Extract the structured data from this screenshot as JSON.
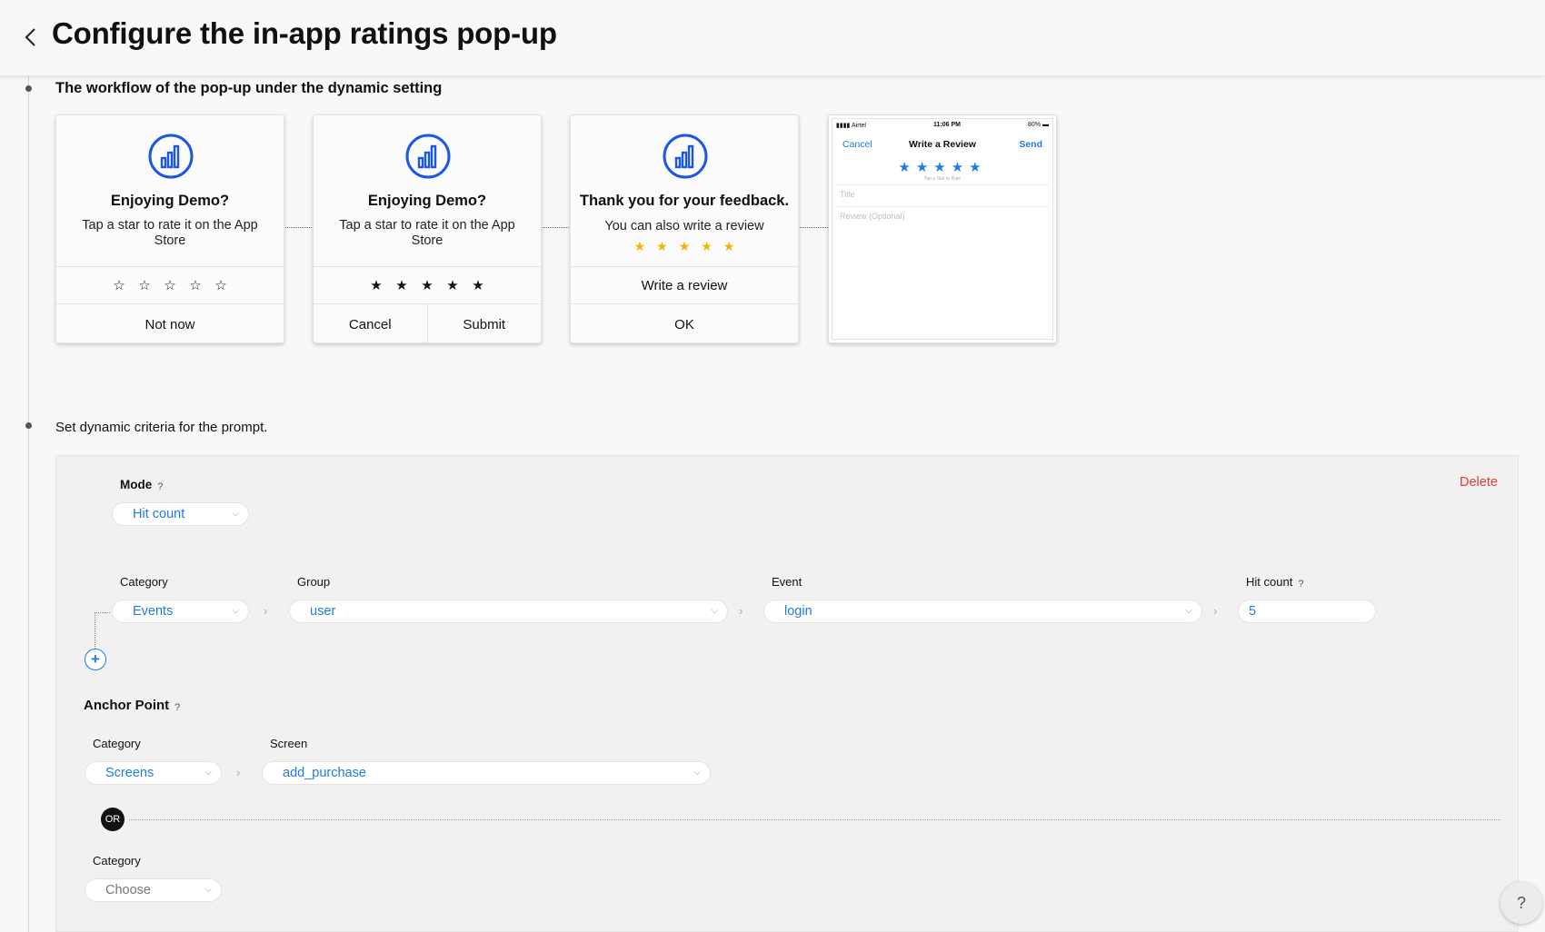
{
  "header": {
    "title": "Configure the in-app ratings pop-up",
    "back_icon": "chevron-left-icon"
  },
  "workflow": {
    "heading": "The workflow of the pop-up under the dynamic setting",
    "cards": [
      {
        "title": "Enjoying Demo?",
        "message": "Tap a star to rate it on the App Store",
        "stars": "empty",
        "actions": [
          "Not now"
        ]
      },
      {
        "title": "Enjoying Demo?",
        "message": "Tap a star to rate it on the App Store",
        "stars": "filled",
        "actions": [
          "Cancel",
          "Submit"
        ]
      },
      {
        "title": "Thank you for your feedback.",
        "message": "You can also write a review",
        "stars": "gold",
        "review_label": "Write a review",
        "actions": [
          "OK"
        ]
      }
    ],
    "phone": {
      "carrier": "Airtel",
      "time": "11:06 PM",
      "battery": "80%",
      "cancel": "Cancel",
      "title": "Write a Review",
      "send": "Send",
      "tap_hint": "Tap a Star to Rate",
      "title_placeholder": "Title",
      "review_placeholder": "Review (Optional)"
    },
    "accent_color": "#1e7be6",
    "star_gold": "#f5b300"
  },
  "criteria": {
    "heading": "Set dynamic criteria for the prompt.",
    "delete_label": "Delete",
    "mode": {
      "label": "Mode",
      "help": "?",
      "value": "Hit count"
    },
    "rule": {
      "category_label": "Category",
      "category_value": "Events",
      "group_label": "Group",
      "group_value": "user",
      "event_label": "Event",
      "event_value": "login",
      "hitcount_label": "Hit count",
      "hitcount_help": "?",
      "hitcount_value": "5"
    },
    "add_label": "+",
    "anchor": {
      "label": "Anchor Point",
      "help": "?",
      "category_label": "Category",
      "category_value": "Screens",
      "screen_label": "Screen",
      "screen_value": "add_purchase",
      "or_label": "OR",
      "category2_label": "Category",
      "category2_value": "Choose"
    }
  },
  "help_fab": "?"
}
